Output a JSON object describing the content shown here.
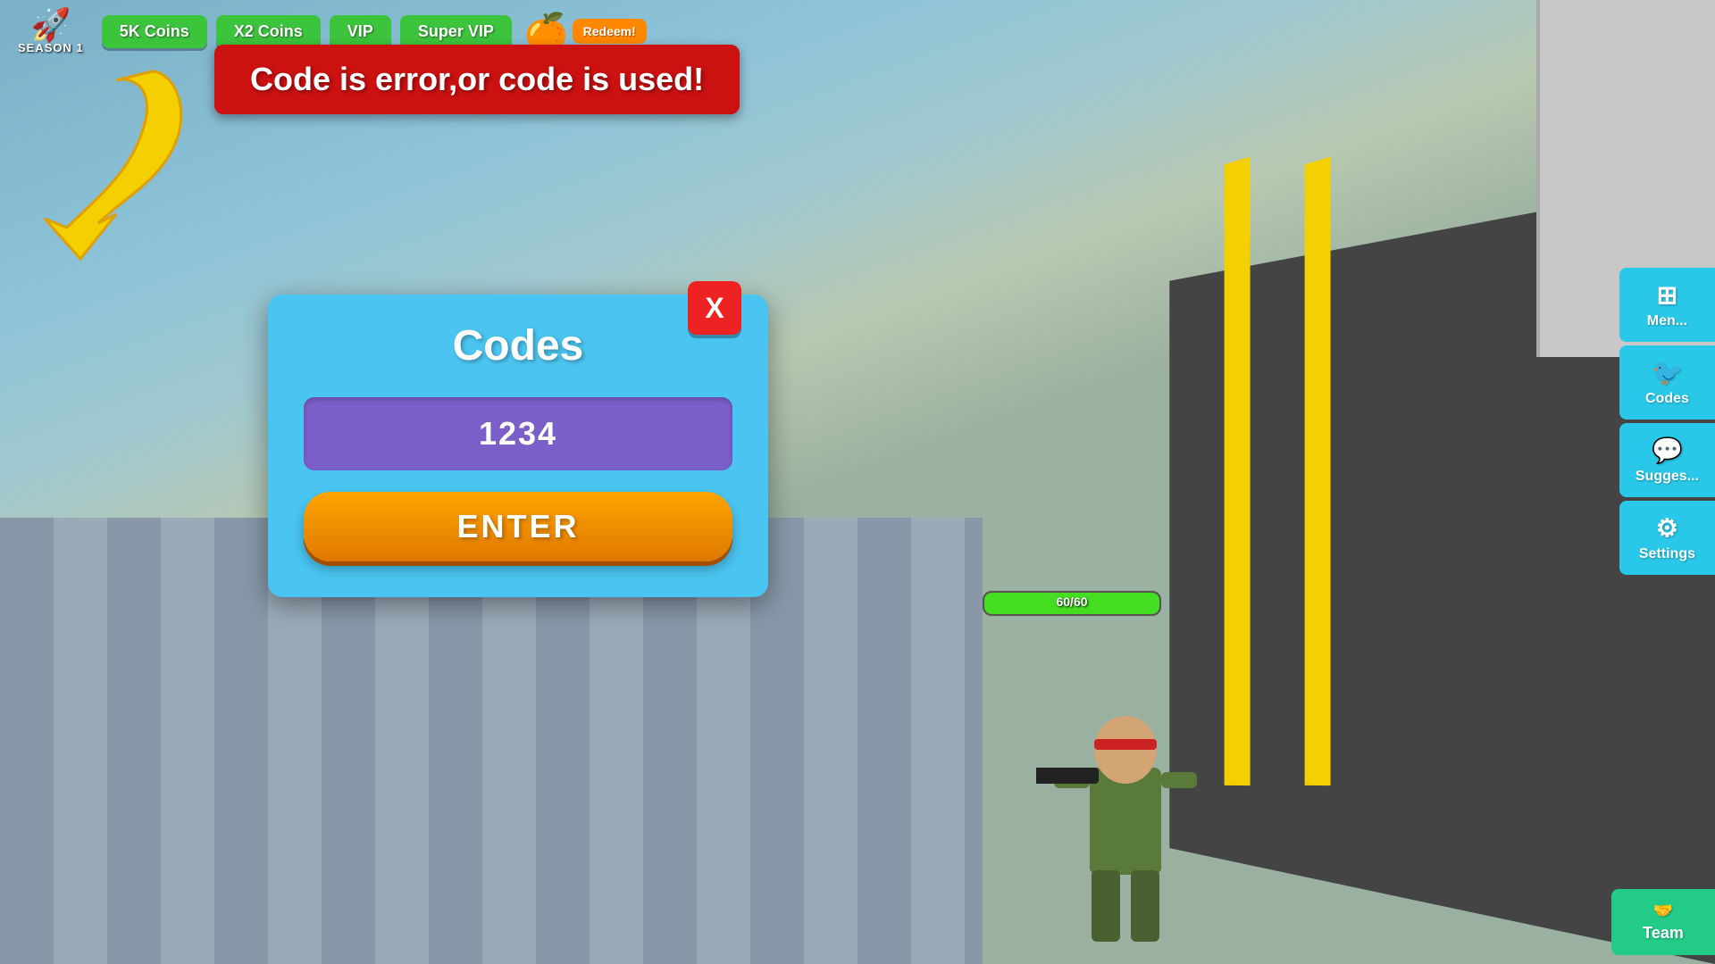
{
  "background": {
    "sky_color": "#7ab0c8",
    "ground_color": "#8898a8"
  },
  "top_hud": {
    "season_label": "SEASON 1",
    "rocket_icon": "🚀",
    "btn_5k_label": "5K Coins",
    "btn_x2_label": "X2 Coins",
    "btn_vip_label": "VIP",
    "btn_super_vip_label": "Super VIP",
    "redeem_label": "Redeem!",
    "redeem_icon": "🍊"
  },
  "error_banner": {
    "text": "Code is error,or code is used!"
  },
  "codes_dialog": {
    "title": "Codes",
    "close_label": "X",
    "code_value": "1234",
    "code_placeholder": "1234",
    "enter_label": "ENTER"
  },
  "right_sidebar": {
    "menu_icon": "⊞",
    "menu_label": "Men...",
    "codes_icon": "🐦",
    "codes_label": "Codes",
    "suggest_icon": "💬",
    "suggest_label": "Sugges...",
    "settings_icon": "⚙",
    "settings_label": "Settings"
  },
  "team_button": {
    "icon": "🤝",
    "label": "Team"
  },
  "health_bar": {
    "current": 60,
    "max": 60,
    "text": "60/60",
    "color": "#44dd22"
  }
}
